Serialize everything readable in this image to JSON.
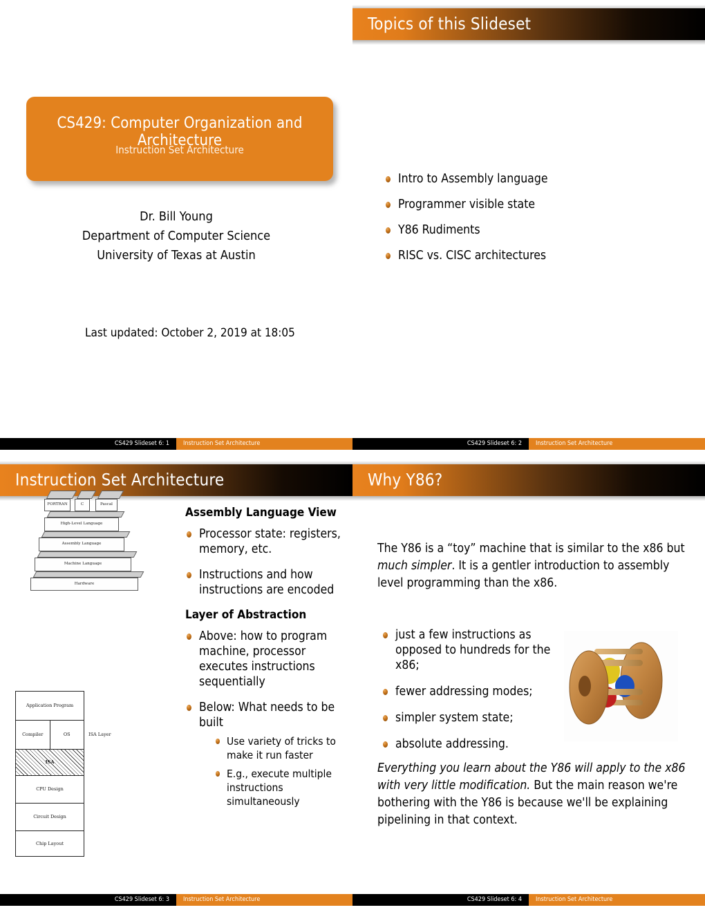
{
  "deck": {
    "course": "CS429",
    "accent_color": "#e3821e",
    "header_dark_color": "#000000",
    "footer_note": "Instruction Set Architecture"
  },
  "slide1": {
    "title_main": "CS429: Computer Organization and Architecture",
    "title_sub": "Instruction Set Architecture",
    "author_lines": [
      "Dr. Bill Young",
      "Department of Computer Science",
      "University of Texas at Austin"
    ],
    "last_updated": "Last updated: October 2, 2019 at 18:05",
    "footer_page": "CS429 Slideset 6: 1",
    "footer_title": "Instruction Set Architecture"
  },
  "slide2": {
    "header": "Topics of this Slideset",
    "topics": [
      "Intro to Assembly language",
      "Programmer visible state",
      "Y86 Rudiments",
      "RISC vs. CISC architectures"
    ],
    "footer_page": "CS429 Slideset 6: 2",
    "footer_title": "Instruction Set Architecture"
  },
  "slide3": {
    "header": "Instruction Set Architecture",
    "pyramid": {
      "top_boxes": [
        "FORTRAN",
        "C",
        "Pascal"
      ],
      "layers": [
        "High-Level Language",
        "Assembly Language",
        "Machine Language",
        "Hardware"
      ]
    },
    "stack": {
      "rows": [
        "Application Program",
        "Compiler",
        "OS",
        "ISA",
        "CPU Design",
        "Circuit Design",
        "Chip Layout"
      ],
      "isa_annotation": "ISA Layer"
    },
    "block1_title": "Assembly Language View",
    "block1_items": [
      "Processor state: registers, memory, etc.",
      "Instructions and how instructions are encoded"
    ],
    "block2_title": "Layer of Abstraction",
    "block2_items": [
      "Above: how to program machine, processor executes instructions sequentially",
      "Below: What needs to be built"
    ],
    "block2_subitems": [
      "Use variety of tricks to make it run faster",
      "E.g., execute multiple instructions simultaneously"
    ],
    "footer_page": "CS429 Slideset 6: 3",
    "footer_title": "Instruction Set Architecture"
  },
  "slide4": {
    "header": "Why Y86?",
    "para1_a": "The Y86 is a “toy” machine that is similar to the x86 but ",
    "para1_em": "much simpler",
    "para1_b": ". It is a gentler introduction to assembly level programming than the x86.",
    "items": [
      "just a few instructions as opposed to hundreds for the x86;",
      "fewer addressing modes;",
      "simpler system state;",
      "absolute addressing."
    ],
    "para2_em": "Everything you learn about the Y86 will apply to the x86 with very little modification.",
    "para2_b": " But the main reason we're bothering with the Y86 is because we'll be explaining pipelining in that context.",
    "footer_page": "CS429 Slideset 6: 4",
    "footer_title": "Instruction Set Architecture"
  }
}
